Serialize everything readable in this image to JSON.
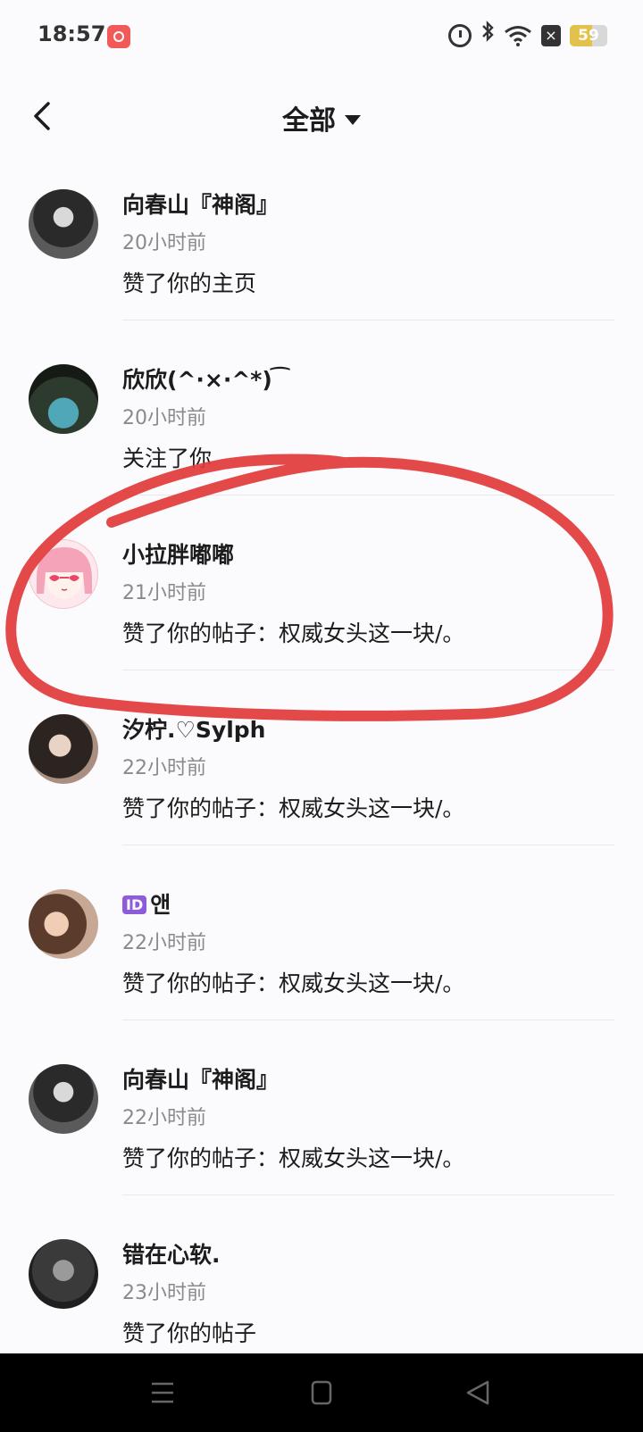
{
  "status": {
    "time": "18:57",
    "battery_level": "59",
    "battery_fraction": 0.59
  },
  "header": {
    "title": "全部"
  },
  "notifications": [
    {
      "nickname": "向春山『神阁』",
      "time": "20小时前",
      "action": "赞了你的主页"
    },
    {
      "nickname": "欣欣(^·×·^*) ͡",
      "time": "20小时前",
      "action": "关注了你"
    },
    {
      "nickname": "小拉胖嘟嘟",
      "time": "21小时前",
      "action": "赞了你的帖子：权威女头这一块/。"
    },
    {
      "nickname": "汐柠.♡Sylph",
      "time": "22小时前",
      "action": "赞了你的帖子：权威女头这一块/。"
    },
    {
      "nickname_badge": "ID",
      "nickname": "앤",
      "time": "22小时前",
      "action": "赞了你的帖子：权威女头这一块/。"
    },
    {
      "nickname": "向春山『神阁』",
      "time": "22小时前",
      "action": "赞了你的帖子：权威女头这一块/。"
    },
    {
      "nickname": "错在心软.",
      "time": "23小时前",
      "action": "赞了你的帖子"
    }
  ],
  "colors": {
    "annotation": "#e23a3a",
    "battery": "#e2c24a"
  }
}
